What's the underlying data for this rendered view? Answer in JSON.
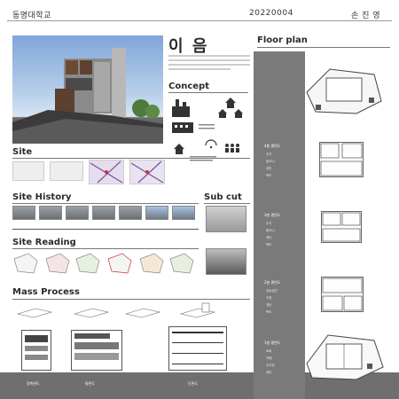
{
  "header": {
    "school": "동명대학교",
    "student_id": "20220004",
    "student_name": "손 진 영"
  },
  "title": {
    "main": "이 음"
  },
  "sections": {
    "concept": "Concept",
    "site": "Site",
    "site_history": "Site History",
    "sub_cut": "Sub cut",
    "site_reading": "Site Reading",
    "mass_process": "Mass Process",
    "floor_plan": "Floor plan"
  },
  "floors": [
    {
      "label": "4층 평면도",
      "items": [
        "주거",
        "발코니",
        "계단",
        "복도"
      ]
    },
    {
      "label": "3층 평면도",
      "items": [
        "주거",
        "발코니",
        "계단",
        "복도"
      ]
    },
    {
      "label": "2층 평면도",
      "items": [
        "공유공간",
        "주방",
        "계단",
        "복도"
      ]
    },
    {
      "label": "1층 평면도",
      "items": [
        "로비",
        "카페",
        "주차장",
        "계단"
      ]
    }
  ],
  "bottom_labels": {
    "left": "정측면도",
    "middle": "평면도",
    "right": "단면도"
  },
  "colors": {
    "accent": "#b21e1e",
    "band": "#7a7a7a"
  }
}
